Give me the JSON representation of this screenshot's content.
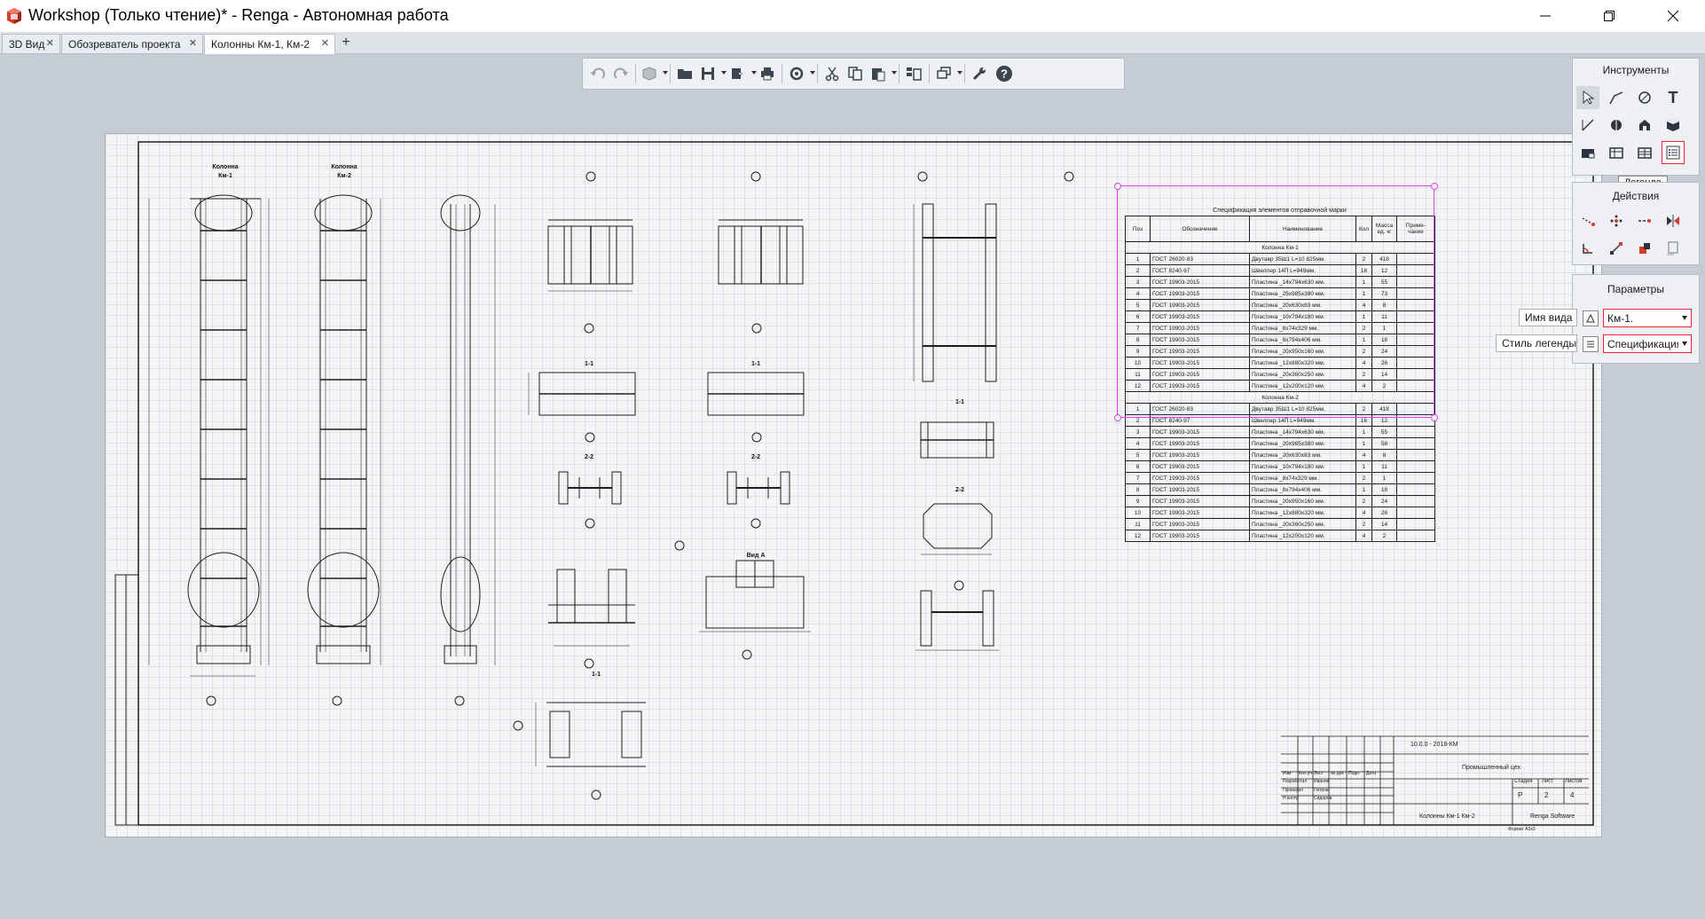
{
  "window": {
    "title": "Workshop (Только чтение)* - Renga - Автономная работа",
    "minimize": "—",
    "maximize": "❐",
    "close": "✕"
  },
  "tabs": [
    {
      "label": "3D Вид"
    },
    {
      "label": "Обозреватель проекта"
    },
    {
      "label": "Колонны Км-1, Км-2"
    }
  ],
  "tab_add": "+",
  "tab_close": "✕",
  "toolbar": {
    "icons": [
      "undo-icon",
      "redo-icon",
      "3d-view-icon",
      "open-folder-icon",
      "save-icon",
      "export-icon",
      "print-icon",
      "sync-icon",
      "cut-icon",
      "copy-icon",
      "paste-icon",
      "levels-icon",
      "layers-icon",
      "settings-wrench-icon",
      "help-icon"
    ],
    "help": "?"
  },
  "panels": {
    "tools": {
      "title": "Инструменты",
      "tooltip": "Легенда",
      "text_tool": "T"
    },
    "actions": {
      "title": "Действия"
    },
    "params": {
      "title": "Параметры",
      "view_name_label": "Имя вида",
      "view_name_value": "Км-1.",
      "legend_style_label": "Стиль легенды",
      "legend_style_value": "Спецификация"
    }
  },
  "drawing": {
    "col1_title": "Колонна",
    "col1_sub": "Км-1",
    "col2_title": "Колонна",
    "col2_sub": "Км-2",
    "sec_1_1": "1-1",
    "sec_2_2": "2-2",
    "view_a": "Вид А"
  },
  "spec": {
    "title": "Спецификация элементов отправочной марки",
    "headers": [
      "Поз",
      "Обозначение",
      "Наименование",
      "Кол",
      "Масса ед. кг",
      "Приме-чание"
    ],
    "group1": "Колонна Км-1",
    "group2": "Колонна Км-2",
    "rows1": [
      [
        "1",
        "ГОСТ 26020-83",
        "Двутавр 35Ш1 L=10 825мм.",
        "2",
        "418",
        ""
      ],
      [
        "2",
        "ГОСТ 8240-97",
        "Швеллер 14П L=949мм.",
        "16",
        "12",
        ""
      ],
      [
        "3",
        "ГОСТ 19903-2015",
        "Пластина _14х794х630 мм.",
        "1",
        "55",
        ""
      ],
      [
        "4",
        "ГОСТ 19903-2015",
        "Пластина _25х985х380 мм.",
        "1",
        "73",
        ""
      ],
      [
        "5",
        "ГОСТ 19903-2015",
        "Пластина _20х630х83 мм.",
        "4",
        "8",
        ""
      ],
      [
        "6",
        "ГОСТ 19903-2015",
        "Пластина _10х794х180 мм.",
        "1",
        "11",
        ""
      ],
      [
        "7",
        "ГОСТ 19903-2015",
        "Пластина _8х74х329 мм.",
        "2",
        "1",
        ""
      ],
      [
        "8",
        "ГОСТ 19903-2015",
        "Пластина _8х794х406 мм.",
        "1",
        "18",
        ""
      ],
      [
        "9",
        "ГОСТ 19903-2015",
        "Пластина _20х950х160 мм.",
        "2",
        "24",
        ""
      ],
      [
        "10",
        "ГОСТ 19903-2015",
        "Пластина _12х880х320 мм.",
        "4",
        "26",
        ""
      ],
      [
        "11",
        "ГОСТ 19903-2015",
        "Пластина _20х360х250 мм.",
        "2",
        "14",
        ""
      ],
      [
        "12",
        "ГОСТ 19903-2015",
        "Пластина _12х200х120 мм.",
        "4",
        "2",
        ""
      ]
    ],
    "rows2": [
      [
        "1",
        "ГОСТ 26020-83",
        "Двутавр 35Ш1 L=10 825мм.",
        "2",
        "418",
        ""
      ],
      [
        "2",
        "ГОСТ 8240-97",
        "Швеллер 14П L=949мм.",
        "16",
        "12",
        ""
      ],
      [
        "3",
        "ГОСТ 19903-2015",
        "Пластина _14х794х630 мм.",
        "1",
        "55",
        ""
      ],
      [
        "4",
        "ГОСТ 19903-2015",
        "Пластина _20х985х380 мм.",
        "1",
        "58",
        ""
      ],
      [
        "5",
        "ГОСТ 19903-2015",
        "Пластина _20х630х83 мм.",
        "4",
        "8",
        ""
      ],
      [
        "6",
        "ГОСТ 19903-2015",
        "Пластина _10х794х180 мм.",
        "1",
        "11",
        ""
      ],
      [
        "7",
        "ГОСТ 19903-2015",
        "Пластина _8х74х329 мм.",
        "2",
        "1",
        ""
      ],
      [
        "8",
        "ГОСТ 19903-2015",
        "Пластина _8х794х406 мм.",
        "1",
        "18",
        ""
      ],
      [
        "9",
        "ГОСТ 19903-2015",
        "Пластина _20х950х160 мм.",
        "2",
        "24",
        ""
      ],
      [
        "10",
        "ГОСТ 19903-2015",
        "Пластина _12х880х320 мм.",
        "4",
        "26",
        ""
      ],
      [
        "11",
        "ГОСТ 19903-2015",
        "Пластина _20х360х250 мм.",
        "2",
        "14",
        ""
      ],
      [
        "12",
        "ГОСТ 19903-2015",
        "Пластина _12х200х120 мм.",
        "4",
        "2",
        ""
      ]
    ]
  },
  "title_block": {
    "code": "10.0.0 - 2018-КМ",
    "object": "Промышленный цех",
    "sheet_name": "Колонны Км-1 Км-2",
    "company": "Renga Software",
    "stage_label": "Стадия",
    "sheet_label": "Лист",
    "sheets_label": "Листов",
    "stage": "Р",
    "sheet": "2",
    "sheets": "4",
    "format": "Формат А3х3",
    "roles": [
      "Разработал",
      "Проверил",
      "Н.контр"
    ],
    "people": [
      "Иванов",
      "Петров",
      "Сидоров"
    ],
    "cols": [
      "Изм",
      "Кол.уч",
      "Лист",
      "№ док",
      "Подп",
      "Дата"
    ]
  },
  "colors": {
    "selection": "#e040e0",
    "highlight": "#e22233",
    "panel_bg": "#eef0f3",
    "workspace_bg": "#c6ccd5"
  }
}
